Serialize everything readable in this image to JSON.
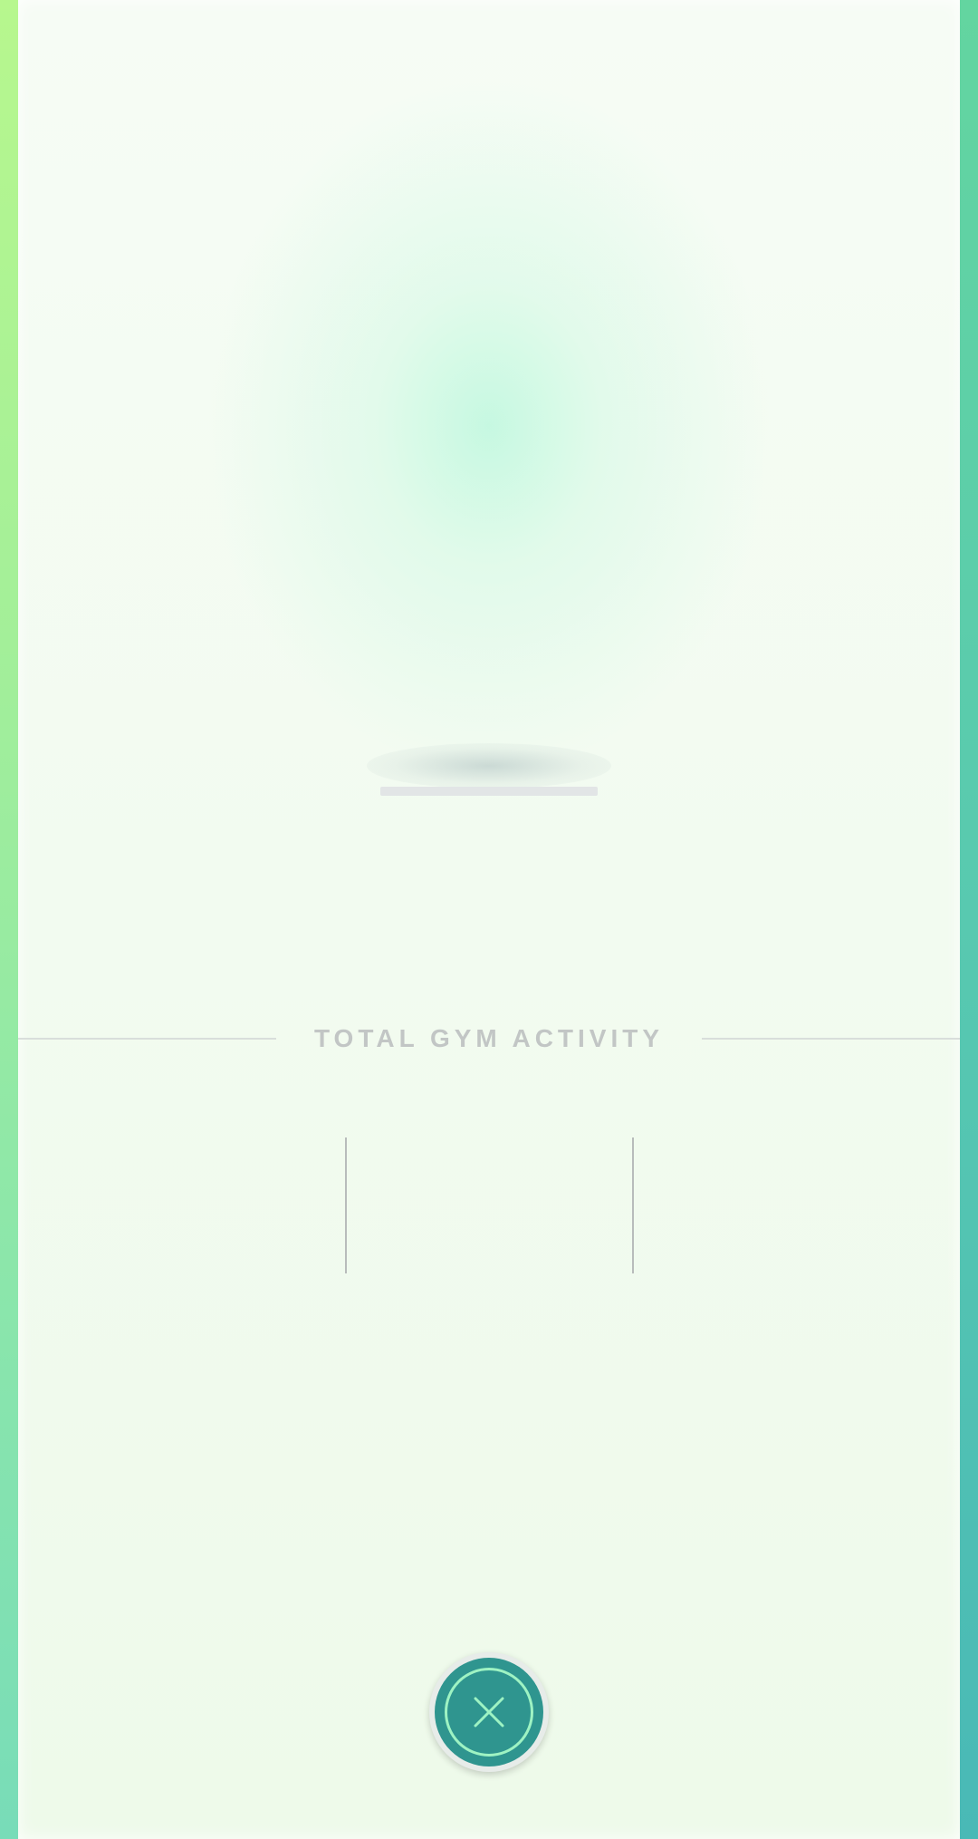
{
  "window": {
    "title": ""
  },
  "colors": {
    "frame_left": "#a3ef99",
    "frame_right": "#58c9b0",
    "panel_background": "#f2fbf0",
    "title_text": "#c2c6c5",
    "close_button_fill": "#2f958f",
    "close_button_ring": "#9ef3c3"
  },
  "header": {
    "progress_fraction": 0
  },
  "activity": {
    "section_title": "TOTAL GYM ACTIVITY"
  },
  "footer": {
    "close_icon": "close-icon"
  }
}
